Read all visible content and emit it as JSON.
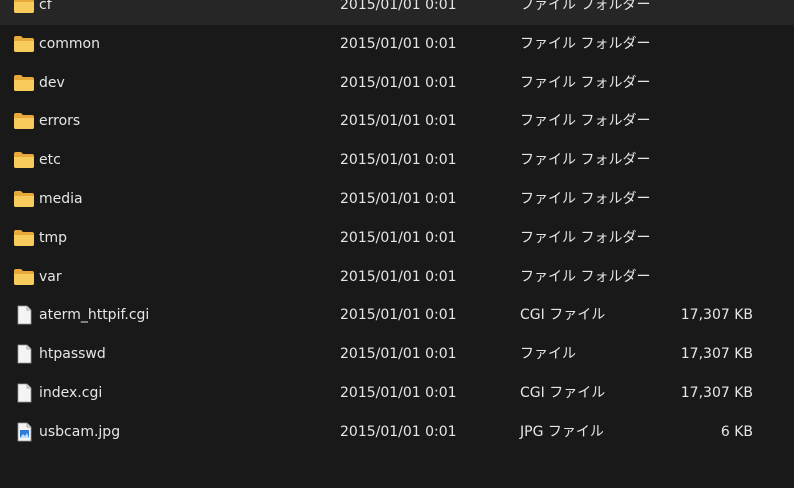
{
  "files": [
    {
      "name": "cf",
      "date": "2015/01/01 0:01",
      "type": "ファイル フォルダー",
      "size": "",
      "icon": "folder-icon"
    },
    {
      "name": "common",
      "date": "2015/01/01 0:01",
      "type": "ファイル フォルダー",
      "size": "",
      "icon": "folder-icon"
    },
    {
      "name": "dev",
      "date": "2015/01/01 0:01",
      "type": "ファイル フォルダー",
      "size": "",
      "icon": "folder-icon"
    },
    {
      "name": "errors",
      "date": "2015/01/01 0:01",
      "type": "ファイル フォルダー",
      "size": "",
      "icon": "folder-icon"
    },
    {
      "name": "etc",
      "date": "2015/01/01 0:01",
      "type": "ファイル フォルダー",
      "size": "",
      "icon": "folder-icon"
    },
    {
      "name": "media",
      "date": "2015/01/01 0:01",
      "type": "ファイル フォルダー",
      "size": "",
      "icon": "folder-icon"
    },
    {
      "name": "tmp",
      "date": "2015/01/01 0:01",
      "type": "ファイル フォルダー",
      "size": "",
      "icon": "folder-icon"
    },
    {
      "name": "var",
      "date": "2015/01/01 0:01",
      "type": "ファイル フォルダー",
      "size": "",
      "icon": "folder-icon"
    },
    {
      "name": "aterm_httpif.cgi",
      "date": "2015/01/01 0:01",
      "type": "CGI ファイル",
      "size": "17,307 KB",
      "icon": "file-icon"
    },
    {
      "name": "htpasswd",
      "date": "2015/01/01 0:01",
      "type": "ファイル",
      "size": "17,307 KB",
      "icon": "file-icon"
    },
    {
      "name": "index.cgi",
      "date": "2015/01/01 0:01",
      "type": "CGI ファイル",
      "size": "17,307 KB",
      "icon": "file-icon"
    },
    {
      "name": "usbcam.jpg",
      "date": "2015/01/01 0:01",
      "type": "JPG ファイル",
      "size": "6 KB",
      "icon": "image-file-icon"
    }
  ]
}
